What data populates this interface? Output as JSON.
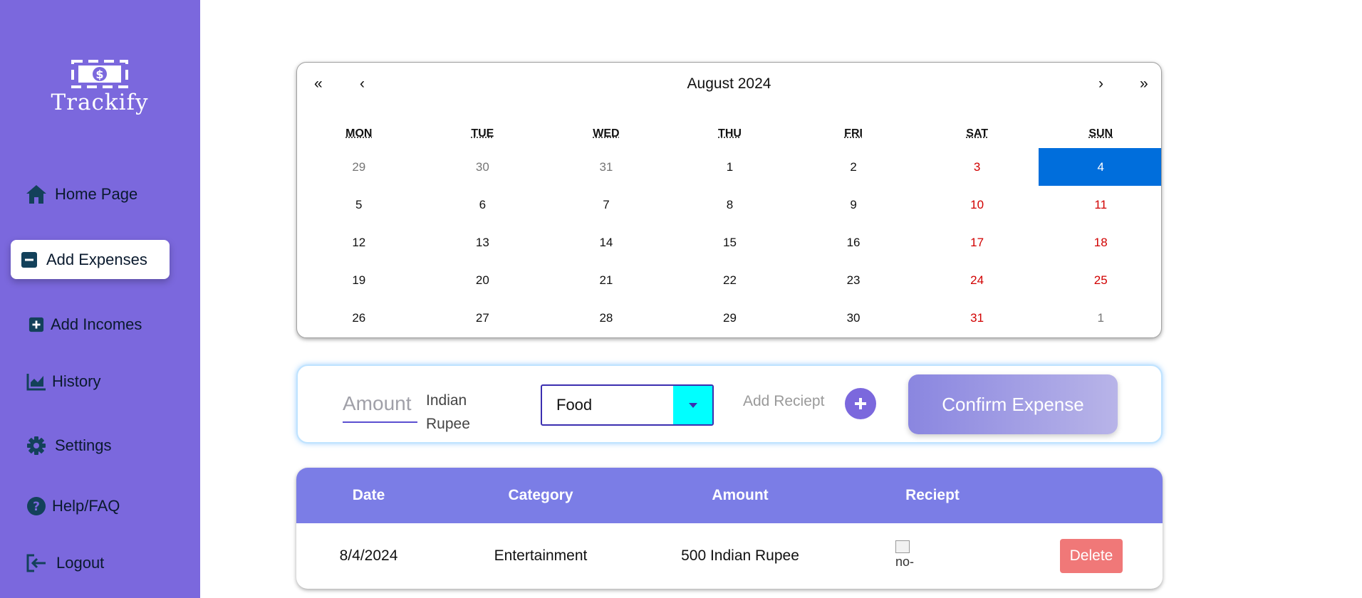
{
  "brand": {
    "name": "Trackify",
    "logo_icon": "dollar-bill-icon"
  },
  "sidebar": {
    "items": [
      {
        "label": "Home Page",
        "icon": "home-icon"
      },
      {
        "label": "Add Expenses",
        "icon": "minus-square-icon",
        "active": true
      },
      {
        "label": "Add Incomes",
        "icon": "plus-square-icon"
      },
      {
        "label": "History",
        "icon": "chart-icon"
      },
      {
        "label": "Settings",
        "icon": "gear-icon"
      },
      {
        "label": "Help/FAQ",
        "icon": "question-circle-icon"
      },
      {
        "label": "Logout",
        "icon": "logout-icon"
      }
    ]
  },
  "calendar": {
    "title": "August 2024",
    "nav": {
      "prev_year": "«",
      "prev_month": "‹",
      "next_month": "›",
      "next_year": "»"
    },
    "weekdays": [
      "MON",
      "TUE",
      "WED",
      "THU",
      "FRI",
      "SAT",
      "SUN"
    ],
    "days": [
      [
        "29",
        "30",
        "31",
        "1",
        "2",
        "3",
        "4"
      ],
      [
        "5",
        "6",
        "7",
        "8",
        "9",
        "10",
        "11"
      ],
      [
        "12",
        "13",
        "14",
        "15",
        "16",
        "17",
        "18"
      ],
      [
        "19",
        "20",
        "21",
        "22",
        "23",
        "24",
        "25"
      ],
      [
        "26",
        "27",
        "28",
        "29",
        "30",
        "31",
        "1"
      ]
    ],
    "selected": "4"
  },
  "form": {
    "amount_placeholder": "Amount",
    "currency": "Indian Rupee",
    "category": "Food",
    "receipt_label": "Add Reciept",
    "confirm_label": "Confirm Expense"
  },
  "table": {
    "headers": [
      "Date",
      "Category",
      "Amount",
      "Reciept"
    ],
    "rows": [
      {
        "date": "8/4/2024",
        "category": "Entertainment",
        "amount": "500 Indian Rupee",
        "receipt_alt": "no-",
        "action": "Delete"
      }
    ]
  },
  "colors": {
    "sidebar": "#7b68dd",
    "selected_day": "#006edc",
    "weekend": "#d10000",
    "table_header": "#7b7de6",
    "delete": "#f07878"
  }
}
